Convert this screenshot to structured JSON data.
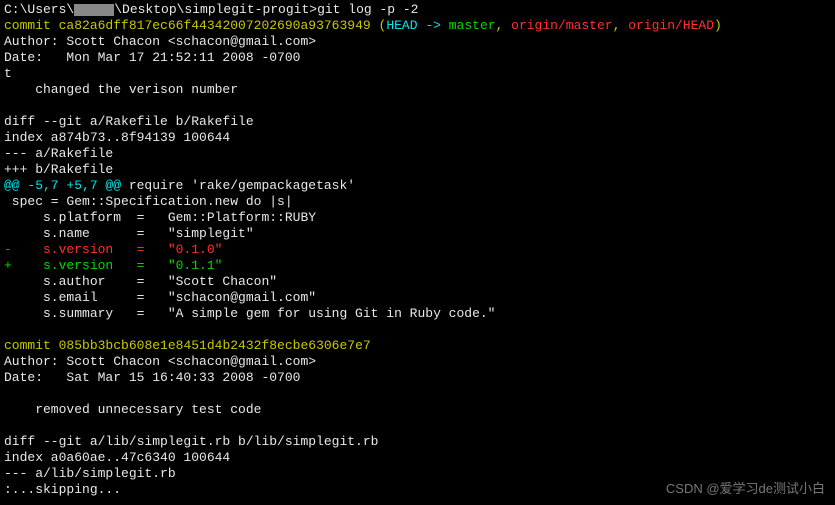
{
  "prompt": {
    "prefix": "C:\\Users\\",
    "suffix": "\\Desktop\\simplegit-progit>",
    "command": "git log -p -2"
  },
  "commit1": {
    "label": "commit",
    "hash": "ca82a6dff817ec66f44342007202690a93763949",
    "ref_open": "(",
    "head": "HEAD -> ",
    "master": "master",
    "sep1": ", ",
    "origin_master": "origin/master",
    "sep2": ", ",
    "origin_head": "origin/HEAD",
    "ref_close": ")",
    "author": "Author: Scott Chacon <schacon@gmail.com>",
    "date": "Date:   Mon Mar 17 21:52:11 2008 -0700",
    "t": "t",
    "message": "    changed the verison number",
    "diff_header": "diff --git a/Rakefile b/Rakefile",
    "index_line": "index a874b73..8f94139 100644",
    "minus_file": "--- a/Rakefile",
    "plus_file": "+++ b/Rakefile",
    "hunk_prefix": "@@ -5,7 +5,7 @@",
    "hunk_suffix": " require 'rake/gempackagetask'",
    "spec_line": " spec = Gem::Specification.new do |s|",
    "platform": "     s.platform  =   Gem::Platform::RUBY",
    "name": "     s.name      =   \"simplegit\"",
    "version_old": "-    s.version   =   \"0.1.0\"",
    "version_new": "+    s.version   =   \"0.1.1\"",
    "author_field": "     s.author    =   \"Scott Chacon\"",
    "email": "     s.email     =   \"schacon@gmail.com\"",
    "summary": "     s.summary   =   \"A simple gem for using Git in Ruby code.\""
  },
  "commit2": {
    "label": "commit",
    "hash": "085bb3bcb608e1e8451d4b2432f8ecbe6306e7e7",
    "author": "Author: Scott Chacon <schacon@gmail.com>",
    "date": "Date:   Sat Mar 15 16:40:33 2008 -0700",
    "message": "    removed unnecessary test code",
    "diff_header": "diff --git a/lib/simplegit.rb b/lib/simplegit.rb",
    "index_line": "index a0a60ae..47c6340 100644",
    "minus_file": "--- a/lib/simplegit.rb",
    "skipping": ":...skipping..."
  },
  "watermark": "CSDN @爱学习de测试小白"
}
